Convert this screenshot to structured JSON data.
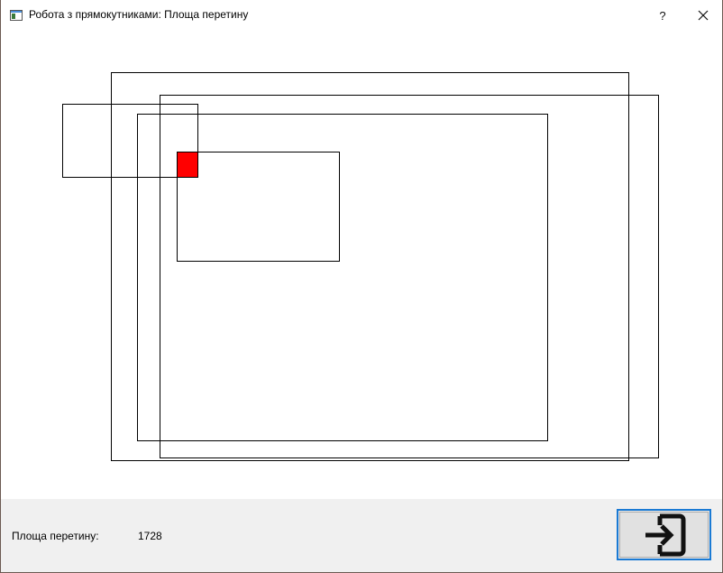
{
  "window": {
    "title": "Робота з прямокутниками: Площа перетину",
    "help_label": "?",
    "icons": {
      "app": "app-window-icon",
      "close": "close-icon",
      "exit": "exit-icon"
    }
  },
  "canvas": {
    "rect_color": "#000000",
    "intersection_color": "#ff0000"
  },
  "footer": {
    "area_label": "Площа перетину:",
    "area_value": "1728"
  }
}
